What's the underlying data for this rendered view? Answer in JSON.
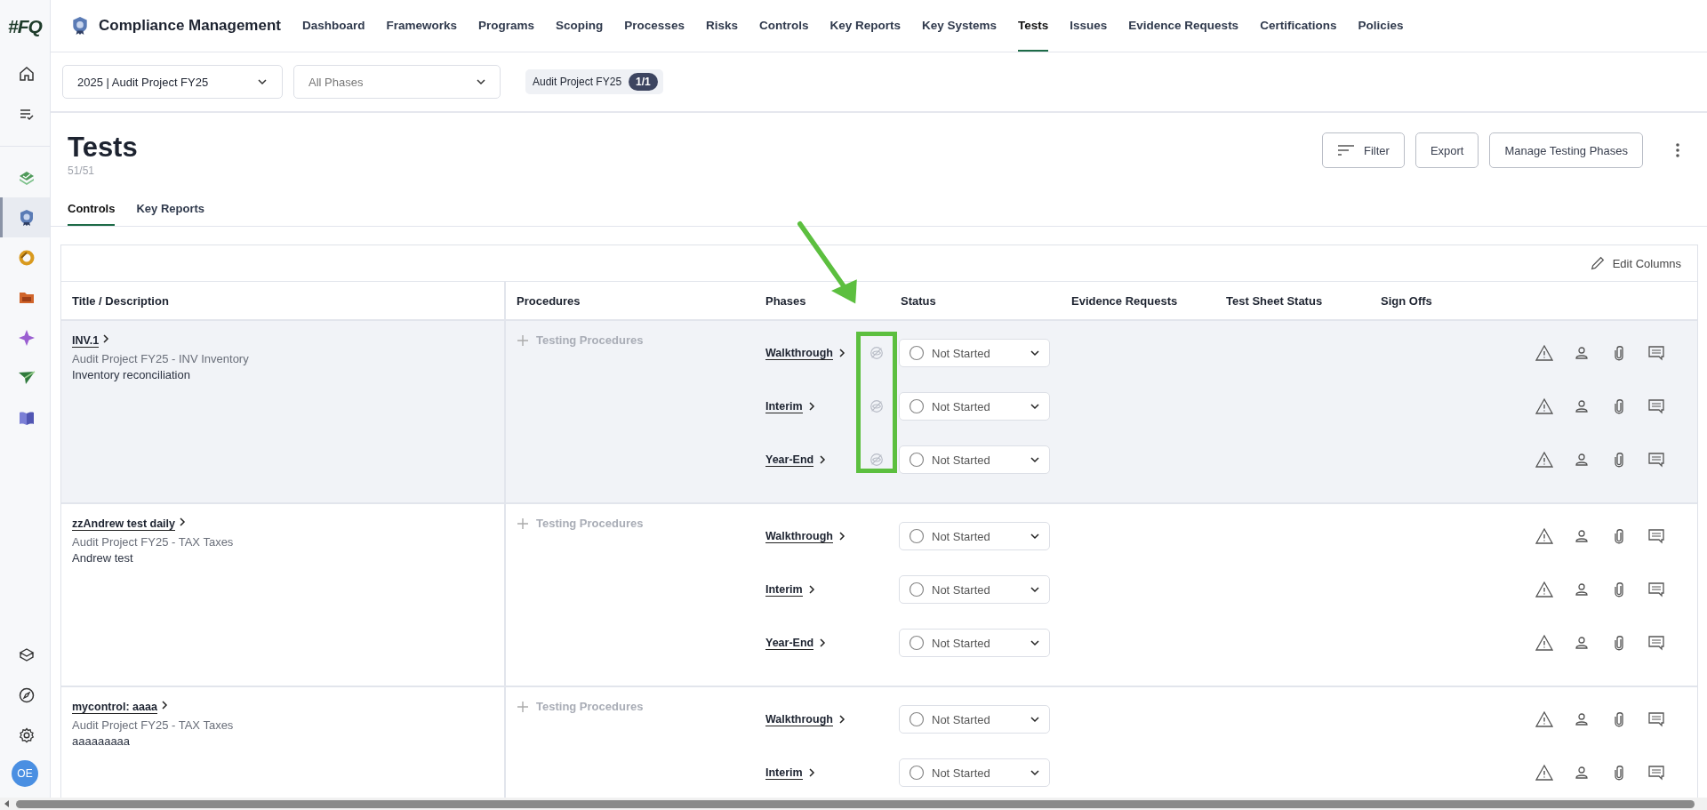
{
  "logo": {
    "text": "#FQ"
  },
  "sidebar": {
    "top": [
      {
        "kind": "home",
        "selected": false
      },
      {
        "kind": "tasks",
        "selected": false
      }
    ],
    "apps": [
      {
        "kind": "layers",
        "selected": false
      },
      {
        "kind": "badge",
        "selected": true
      },
      {
        "kind": "ring",
        "selected": false
      },
      {
        "kind": "folder",
        "selected": false
      },
      {
        "kind": "sparkle",
        "selected": false
      },
      {
        "kind": "plane",
        "selected": false
      },
      {
        "kind": "book",
        "selected": false
      }
    ],
    "bottom": [
      {
        "kind": "cube",
        "selected": false
      },
      {
        "kind": "compass",
        "selected": false
      },
      {
        "kind": "gear",
        "selected": false
      }
    ],
    "avatar": "OE"
  },
  "app": {
    "title": "Compliance Management"
  },
  "nav": [
    {
      "label": "Dashboard",
      "selected": false
    },
    {
      "label": "Frameworks",
      "selected": false
    },
    {
      "label": "Programs",
      "selected": false
    },
    {
      "label": "Scoping",
      "selected": false
    },
    {
      "label": "Processes",
      "selected": false
    },
    {
      "label": "Risks",
      "selected": false
    },
    {
      "label": "Controls",
      "selected": false
    },
    {
      "label": "Key Reports",
      "selected": false
    },
    {
      "label": "Key Systems",
      "selected": false
    },
    {
      "label": "Tests",
      "selected": true
    },
    {
      "label": "Issues",
      "selected": false
    },
    {
      "label": "Evidence Requests",
      "selected": false
    },
    {
      "label": "Certifications",
      "selected": false
    },
    {
      "label": "Policies",
      "selected": false
    }
  ],
  "filters": {
    "project": "2025 | Audit Project FY25",
    "phases": {
      "placeholder": "All Phases"
    },
    "chip": {
      "label": "Audit Project FY25",
      "count": "1/1"
    }
  },
  "page": {
    "title": "Tests",
    "count": "51/51",
    "buttons": [
      {
        "label": "Filter",
        "has_icon": true
      },
      {
        "label": "Export",
        "has_icon": false
      },
      {
        "label": "Manage Testing Phases",
        "has_icon": false
      }
    ]
  },
  "tabs": [
    {
      "label": "Controls",
      "selected": true
    },
    {
      "label": "Key Reports",
      "selected": false
    }
  ],
  "table": {
    "edit_columns": "Edit Columns",
    "columns": [
      "Title / Description",
      "Procedures",
      "Phases",
      "Status",
      "Evidence Requests",
      "Test Sheet Status",
      "Sign Offs"
    ],
    "rows": [
      {
        "title": "INV.1",
        "project": "Audit Project FY25 - INV Inventory",
        "description": "Inventory reconciliation",
        "procedures": "Testing Procedures",
        "selected": true,
        "phases": [
          {
            "name": "Walkthrough",
            "hidden": true,
            "status": "Not Started"
          },
          {
            "name": "Interim",
            "hidden": true,
            "status": "Not Started"
          },
          {
            "name": "Year-End",
            "hidden": true,
            "status": "Not Started"
          }
        ]
      },
      {
        "title": "zzAndrew test daily",
        "project": "Audit Project FY25 - TAX Taxes",
        "description": "Andrew test",
        "procedures": "Testing Procedures",
        "selected": false,
        "phases": [
          {
            "name": "Walkthrough",
            "hidden": false,
            "status": "Not Started"
          },
          {
            "name": "Interim",
            "hidden": false,
            "status": "Not Started"
          },
          {
            "name": "Year-End",
            "hidden": false,
            "status": "Not Started"
          }
        ]
      },
      {
        "title": "mycontrol: aaaa",
        "project": "Audit Project FY25 - TAX Taxes",
        "description": "aaaaaaaaa",
        "procedures": "Testing Procedures",
        "selected": false,
        "phases": [
          {
            "name": "Walkthrough",
            "hidden": false,
            "status": "Not Started"
          },
          {
            "name": "Interim",
            "hidden": false,
            "status": "Not Started"
          }
        ]
      }
    ]
  }
}
